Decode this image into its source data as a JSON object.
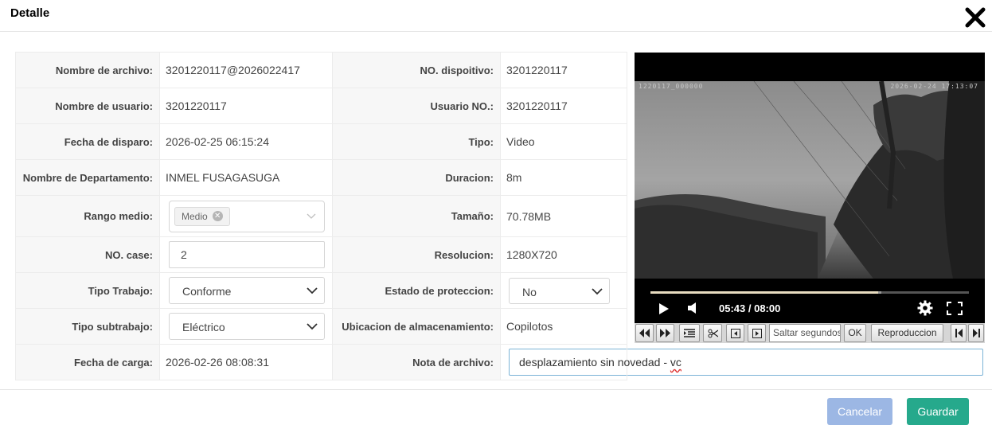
{
  "header": {
    "title": "Detalle"
  },
  "fields": {
    "nombre_archivo": {
      "label": "Nombre de archivo:",
      "value": "3201220117@2026022417"
    },
    "no_dispositivo": {
      "label": "NO. dispoitivo:",
      "value": "3201220117"
    },
    "nombre_usuario": {
      "label": "Nombre de usuario:",
      "value": "3201220117"
    },
    "usuario_no": {
      "label": "Usuario NO.:",
      "value": "3201220117"
    },
    "fecha_disparo": {
      "label": "Fecha de disparo:",
      "value": "2026-02-25 06:15:24"
    },
    "tipo": {
      "label": "Tipo:",
      "value": "Video"
    },
    "nombre_departamento": {
      "label": "Nombre de Departamento:",
      "value": "INMEL FUSAGASUGA"
    },
    "duracion": {
      "label": "Duracion:",
      "value": "8m"
    },
    "rango_medio": {
      "label": "Rango medio:",
      "tag": "Medio"
    },
    "tamano": {
      "label": "Tamaño:",
      "value": "70.78MB"
    },
    "no_case": {
      "label": "NO. case:",
      "value": "2"
    },
    "resolucion": {
      "label": "Resolucion:",
      "value": "1280X720"
    },
    "tipo_trabajo": {
      "label": "Tipo Trabajo:",
      "value": "Conforme"
    },
    "estado_proteccion": {
      "label": "Estado de proteccion:",
      "value": "No"
    },
    "tipo_subtrabajo": {
      "label": "Tipo subtrabajo:",
      "value": "Eléctrico"
    },
    "ubicacion": {
      "label": "Ubicacion de almacenamiento:",
      "value": "Copilotos"
    },
    "fecha_carga": {
      "label": "Fecha de carga:",
      "value": "2026-02-26 08:08:31"
    },
    "nota_archivo": {
      "label": "Nota de archivo:",
      "value_main": "desplazamiento sin novedad - ",
      "value_flagged": "vc"
    }
  },
  "player": {
    "osd_left": "1220117_000000",
    "osd_right": "2026-02-24 17:13:07",
    "time": "05:43 / 08:00",
    "progress": 0.715,
    "buffered": 0.725
  },
  "controls": {
    "seek_placeholder": "Saltar segundos",
    "ok_label": "OK",
    "reproduccion_label": "Reproduccion"
  },
  "footer": {
    "cancel_label": "Cancelar",
    "save_label": "Guardar"
  },
  "colors": {
    "cancel_button": "#9cb7e4",
    "save_button": "#26a98c"
  }
}
